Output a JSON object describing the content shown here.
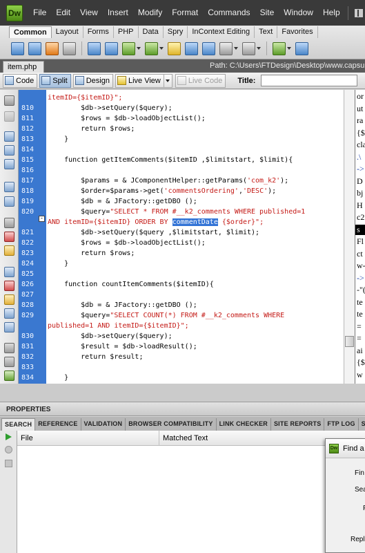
{
  "app": {
    "logo_text": "Dw"
  },
  "menu": [
    "File",
    "Edit",
    "View",
    "Insert",
    "Modify",
    "Format",
    "Commands",
    "Site",
    "Window",
    "Help"
  ],
  "insert_bar": {
    "tabs": [
      "Common",
      "Layout",
      "Forms",
      "PHP",
      "Data",
      "Spry",
      "InContext Editing",
      "Text",
      "Favorites"
    ],
    "active_tab": "Common",
    "icons": [
      "hyperlink-icon",
      "email-link-icon",
      "named-anchor-icon",
      "horizontal-rule-icon",
      "table-icon",
      "insert-div-icon",
      "images-icon",
      "media-icon",
      "date-icon",
      "server-side-include-icon",
      "comment-icon",
      "head-icon",
      "script-icon",
      "templates-icon",
      "tag-chooser-icon"
    ]
  },
  "document": {
    "tab_label": "item.php",
    "path_label": "Path:",
    "path": "C:\\Users\\FTDesign\\Desktop\\www.capsula"
  },
  "doc_toolbar": {
    "code": "Code",
    "split": "Split",
    "design": "Design",
    "live_view": "Live View",
    "live_code": "Live Code",
    "title_label": "Title:",
    "title_value": ""
  },
  "code": {
    "line_numbers": [
      "810",
      "811",
      "812",
      "813",
      "814",
      "815",
      "816",
      "817",
      "818",
      "819",
      "820",
      "",
      "821",
      "822",
      "823",
      "824",
      "825",
      "826",
      "827",
      "828",
      "829",
      "",
      "830",
      "831",
      "832",
      "833",
      "834"
    ],
    "first_line": "itemID={$itemID}\";",
    "lines": [
      [
        {
          "t": "        $db->setQuery($query);",
          "c": "var"
        }
      ],
      [
        {
          "t": "        $rows = $db->loadObjectList();",
          "c": "var"
        }
      ],
      [
        {
          "t": "        return $rows;",
          "c": "var"
        }
      ],
      [
        {
          "t": "    }",
          "c": "var"
        }
      ],
      [
        {
          "t": "",
          "c": "var"
        }
      ],
      [
        {
          "t": "    function getItemComments($itemID ,$limitstart, $limit){",
          "c": "var"
        }
      ],
      [
        {
          "t": "",
          "c": "var"
        }
      ],
      [
        {
          "t": "        $params = & JComponentHelper::getParams(",
          "c": "var"
        },
        {
          "t": "'com_k2'",
          "c": "str"
        },
        {
          "t": ");",
          "c": "var"
        }
      ],
      [
        {
          "t": "        $order=$params->get(",
          "c": "var"
        },
        {
          "t": "'commentsOrdering'",
          "c": "str"
        },
        {
          "t": ",",
          "c": "var"
        },
        {
          "t": "'DESC'",
          "c": "str"
        },
        {
          "t": ");",
          "c": "var"
        }
      ],
      [
        {
          "t": "        $db = & JFactory::getDBO ();",
          "c": "var"
        }
      ],
      [
        {
          "t": "        $query=",
          "c": "var"
        },
        {
          "t": "\"SELECT * FROM #__k2_comments WHERE published=1",
          "c": "str"
        }
      ],
      [
        {
          "t": "AND itemID={$itemID} ORDER BY ",
          "c": "str"
        },
        {
          "t": "commentDate",
          "c": "hl"
        },
        {
          "t": " {$order}\";",
          "c": "str"
        }
      ],
      [
        {
          "t": "        $db->setQuery($query ,$limitstart, $limit);",
          "c": "var"
        }
      ],
      [
        {
          "t": "        $rows = $db->loadObjectList();",
          "c": "var"
        }
      ],
      [
        {
          "t": "        return $rows;",
          "c": "var"
        }
      ],
      [
        {
          "t": "    }",
          "c": "var"
        }
      ],
      [
        {
          "t": "",
          "c": "var"
        }
      ],
      [
        {
          "t": "    function countItemComments($itemID){",
          "c": "var"
        }
      ],
      [
        {
          "t": "",
          "c": "var"
        }
      ],
      [
        {
          "t": "        $db = & JFactory::getDBO ();",
          "c": "var"
        }
      ],
      [
        {
          "t": "        $query=",
          "c": "var"
        },
        {
          "t": "\"SELECT COUNT(*) FROM #__k2_comments WHERE",
          "c": "str"
        }
      ],
      [
        {
          "t": "published=1 AND itemID={$itemID}\";",
          "c": "str"
        }
      ],
      [
        {
          "t": "        $db->setQuery($query);",
          "c": "var"
        }
      ],
      [
        {
          "t": "        $result = $db->loadResult();",
          "c": "var"
        }
      ],
      [
        {
          "t": "        return $result;",
          "c": "var"
        }
      ],
      [
        {
          "t": "",
          "c": "var"
        }
      ],
      [
        {
          "t": "    }",
          "c": "var"
        }
      ]
    ]
  },
  "live_view_fragments": [
    "or",
    "ut",
    "ra",
    "{$",
    "cla",
    ".\\",
    "->",
    "D",
    "bj",
    "H",
    "c2",
    "s",
    "Fl",
    "ct",
    "w-",
    "->",
    "-\"(",
    "te",
    "te",
    "=",
    "=",
    "ai",
    "{$",
    "w"
  ],
  "panels": {
    "properties": "PROPERTIES",
    "results_tabs": [
      "SEARCH",
      "REFERENCE",
      "VALIDATION",
      "BROWSER COMPATIBILITY",
      "LINK CHECKER",
      "SITE REPORTS",
      "FTP LOG",
      "S"
    ],
    "active_results_tab": "SEARCH",
    "columns": [
      "File",
      "Matched Text"
    ]
  },
  "find_dialog": {
    "title": "Find a",
    "labels": [
      "Fin",
      "Sea",
      "F",
      "Repl"
    ]
  }
}
